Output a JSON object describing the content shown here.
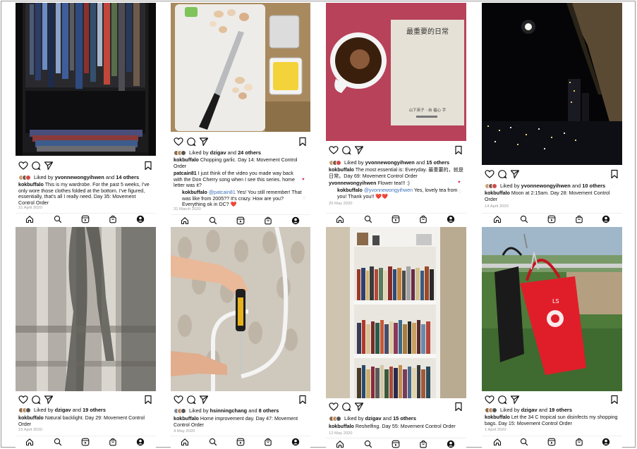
{
  "posts": [
    {
      "liked_user": "yvonnewongyihwen",
      "liked_count": "14 others",
      "username": "kokbuffalo",
      "caption": "This is my wardrobe. For the past 5 weeks, I've only wore those clothes folded at the bottom. I've figured, essentially, that's all I really need. Day 35: Movement Control Order",
      "date": "21 April 2020"
    },
    {
      "liked_user": "dzigav",
      "liked_count": "24 others",
      "username": "kokbuffalo",
      "caption": "Chopping garlic. Day 14: Movement Control Order",
      "comment_user": "patcain81",
      "comment_text": "I just think of the video you made way back with the Don Cherry song when I see this series. home letter was it?",
      "reply_user": "kokbuffalo",
      "reply_mention": "@patcain81",
      "reply_text": "Yes! You still remember! That was like from 2005?? It's crazy. How are you? Everything ok in DC? ❤️",
      "date": "31 March 2020"
    },
    {
      "liked_user": "yvonnewongyihwen",
      "liked_count": "15 others",
      "username": "kokbuffalo",
      "caption": "The most essential is: Everyday. 最重要的，就是日常。Day 69: Movement Control Order",
      "comment_user": "yvonnewongyihwen",
      "comment_text": "Flower tea!!! :)",
      "reply_user": "kokbuffalo",
      "reply_mention": "@yvonnewongyihwen",
      "reply_text": "Yes, lovely tea from you! Thank you!! ❤️❤️",
      "date": "26 May 2020",
      "book_title": "最重要的日常",
      "book_subtitle": "山下英子 · 自 福心 手"
    },
    {
      "liked_user": "yvonnewongyihwen",
      "liked_count": "10 others",
      "username": "kokbuffalo",
      "caption": "Moon at 2:15am. Day 28: Movement Control Order",
      "date": "14 April 2020"
    },
    {
      "liked_user": "dzigav",
      "liked_count": "19 others",
      "username": "kokbuffalo",
      "caption": "Natural backlight. Day 29: Movement Control Order",
      "date": "15 April 2020"
    },
    {
      "liked_user": "hsinningchang",
      "liked_count": "8 others",
      "username": "kokbuffalo",
      "caption": "Home improvement day. Day 47: Movement Control Order",
      "date": "4 May 2020"
    },
    {
      "liked_user": "dzigav",
      "liked_count": "15 others",
      "username": "kokbuffalo",
      "caption": "Reshelfing. Day 55: Movement Control Order",
      "date": "12 May 2020"
    },
    {
      "liked_user": "dzigav",
      "liked_count": "19 others",
      "username": "kokbuffalo",
      "caption": "Let the 34 C tropical sun disinfects my shopping bags. Day 15: Movement Control Order",
      "date": "1 April 2020",
      "bag_text": "LS"
    }
  ],
  "labels": {
    "liked_by": "Liked by",
    "and": "and"
  },
  "colors": {
    "accent_red": "#e0245e",
    "mention_blue": "#3b6fb6"
  }
}
